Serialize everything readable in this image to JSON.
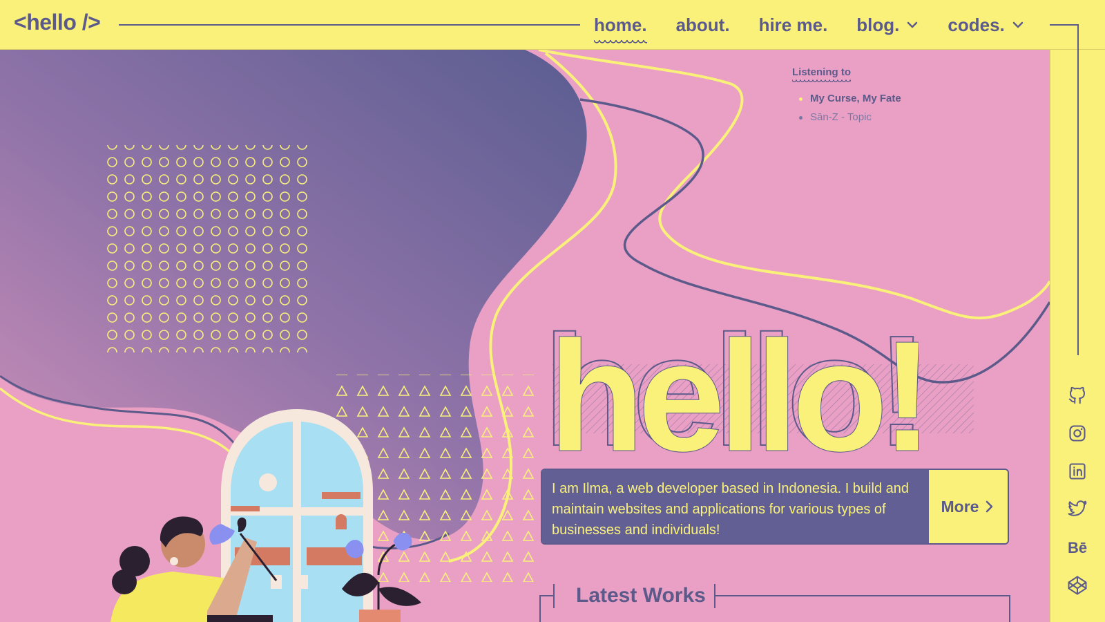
{
  "header": {
    "logo": "<hello />",
    "nav": [
      {
        "label": "home.",
        "active": true,
        "dropdown": false
      },
      {
        "label": "about.",
        "active": false,
        "dropdown": false
      },
      {
        "label": "hire me.",
        "active": false,
        "dropdown": false
      },
      {
        "label": "blog.",
        "active": false,
        "dropdown": true
      },
      {
        "label": "codes.",
        "active": false,
        "dropdown": true
      }
    ]
  },
  "listening": {
    "title": "Listening to",
    "song": "My Curse, My Fate",
    "artist": "Sān-Z - Topic"
  },
  "hero": {
    "headline": "hello!"
  },
  "intro": {
    "text": "I am Ilma, a web developer based in Indonesia. I build and maintain websites and applications for various types of businesses and individuals!",
    "button_label": "More"
  },
  "latest": {
    "title": "Latest Works"
  },
  "social": [
    "github-icon",
    "instagram-icon",
    "linkedin-icon",
    "twitter-icon",
    "behance-icon",
    "codepen-icon"
  ],
  "colors": {
    "yellow": "#f9f17a",
    "pink": "#e9a0c4",
    "purple": "#5b5a8a",
    "intro_bg": "#625f94"
  }
}
